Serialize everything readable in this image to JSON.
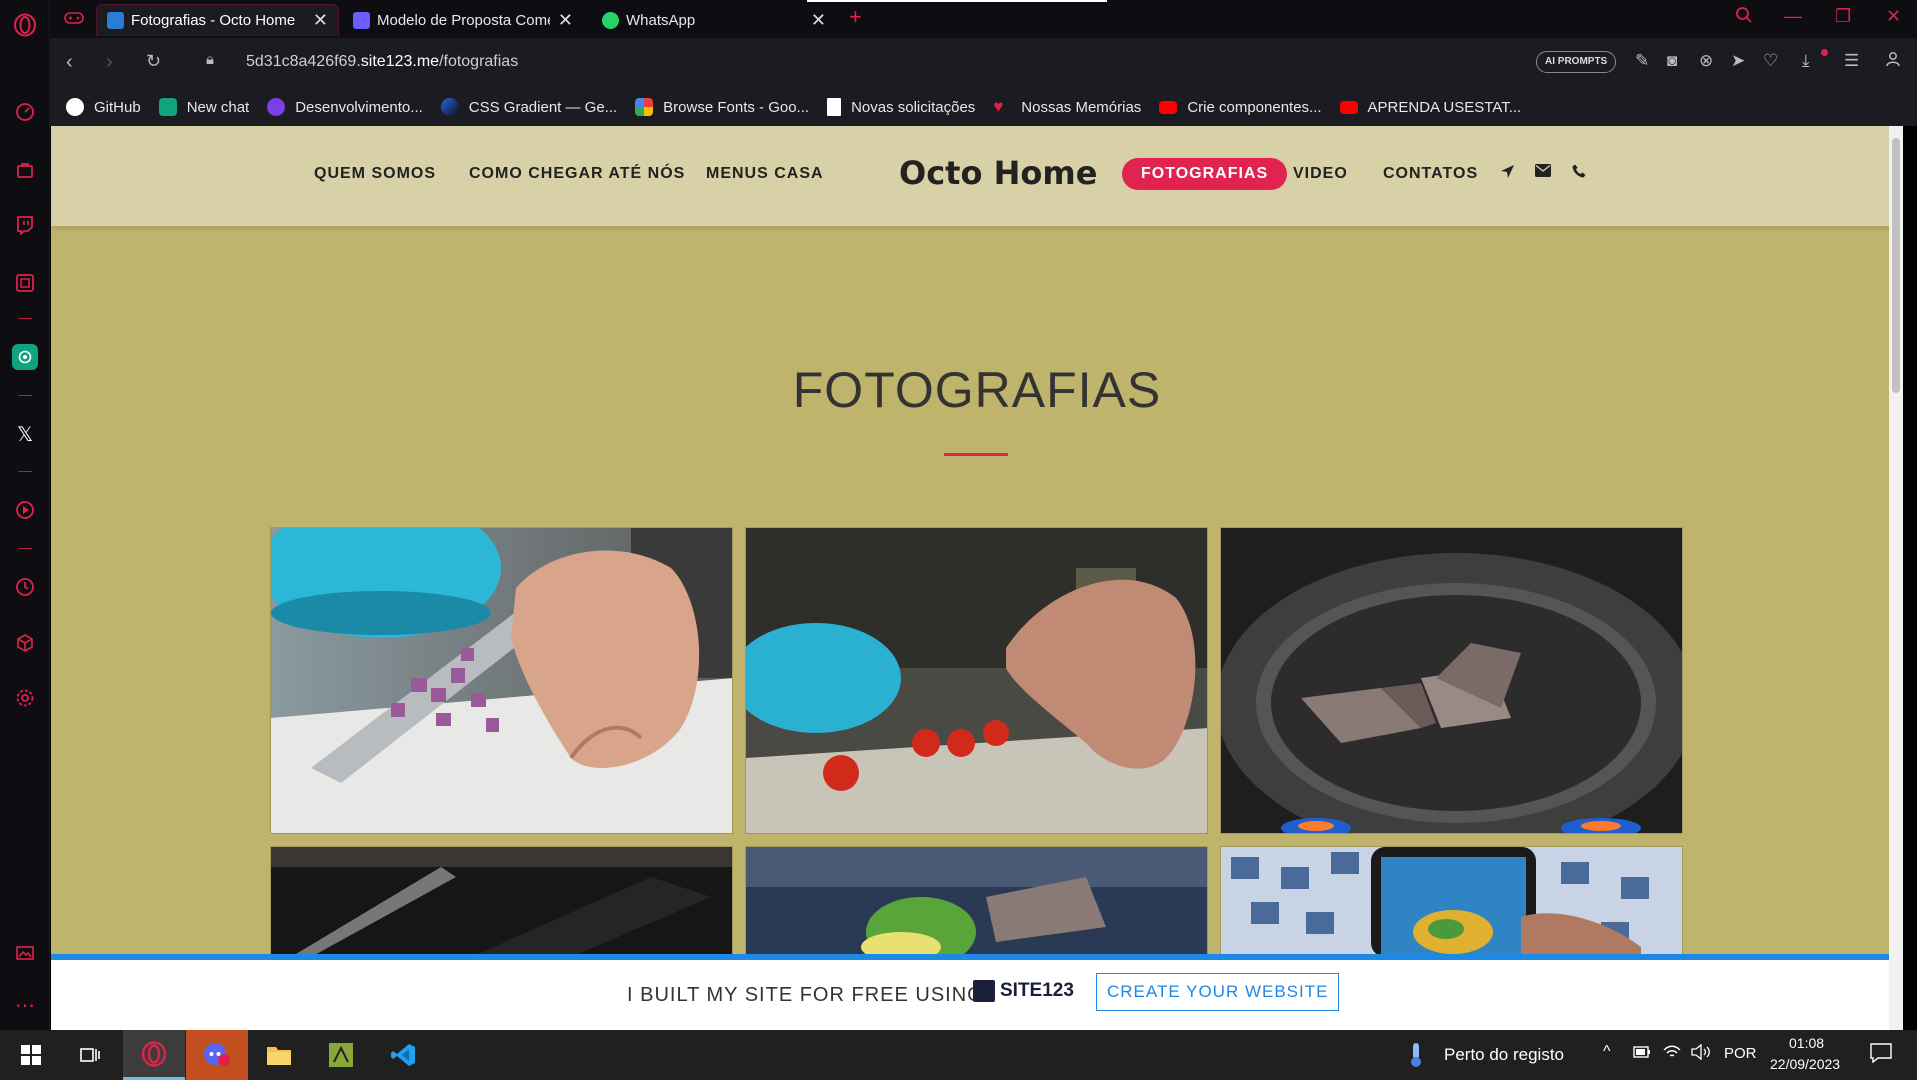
{
  "browser": {
    "tabs": [
      {
        "label": "Fotografias - Octo Home",
        "active": true,
        "favicon_color": "#2b7cd3"
      },
      {
        "label": "Modelo de Proposta Come",
        "active": false,
        "favicon_color": "#6a5cff"
      },
      {
        "label": "WhatsApp",
        "active": false,
        "favicon_color": "#25d366"
      }
    ],
    "url_prefix": "5d31c8a426f69.",
    "url_domain": "site123.me",
    "url_path": "/fotografias",
    "ai_prompts_label": "AI PROMPTS",
    "accent_color": "#e0224b",
    "bookmarks": [
      {
        "label": "GitHub",
        "icon_color": "#ffffff"
      },
      {
        "label": "New chat",
        "icon_color": "#10a37f"
      },
      {
        "label": "Desenvolvimento...",
        "icon_color": "#7b3fe4"
      },
      {
        "label": "CSS Gradient — Ge...",
        "icon_color": "#2563eb"
      },
      {
        "label": "Browse Fonts - Goo...",
        "icon_color": "#f4b400"
      },
      {
        "label": "Novas solicitações",
        "icon_color": "#ffffff"
      },
      {
        "label": "Nossas Memórias",
        "icon_color": "#e0224b"
      },
      {
        "label": "Crie componentes...",
        "icon_color": "#ff0000"
      },
      {
        "label": "APRENDA USESTAT...",
        "icon_color": "#ff0000"
      }
    ]
  },
  "site": {
    "brand": "Octo Home",
    "nav": {
      "quem_somos": "QUEM SOMOS",
      "como_chegar": "COMO CHEGAR ATÉ NÓS",
      "menus_casa": "MENUS CASA",
      "fotografias": "FOTOGRAFIAS",
      "video": "VIDEO",
      "contatos": "CONTATOS"
    },
    "page_title": "FOTOGRAFIAS",
    "background_color": "#bfb46c",
    "header_color": "#d8d0a6",
    "active_color": "#e0244f",
    "photos": [
      {
        "subject": "knife-chopping-red-onion"
      },
      {
        "subject": "hands-picking-cherry-tomatoes"
      },
      {
        "subject": "tuna-steaks-in-pan"
      },
      {
        "subject": "knife-on-board"
      },
      {
        "subject": "plated-dish-with-herbs"
      },
      {
        "subject": "phone-photographing-dish"
      }
    ]
  },
  "footer_banner": {
    "text": "I BUILT MY SITE FOR FREE USING",
    "logo_text": "SITE123",
    "button_label": "CREATE YOUR WEBSITE"
  },
  "taskbar": {
    "weather_text": "Perto do registo",
    "language": "POR",
    "time": "01:08",
    "date": "22/09/2023"
  }
}
